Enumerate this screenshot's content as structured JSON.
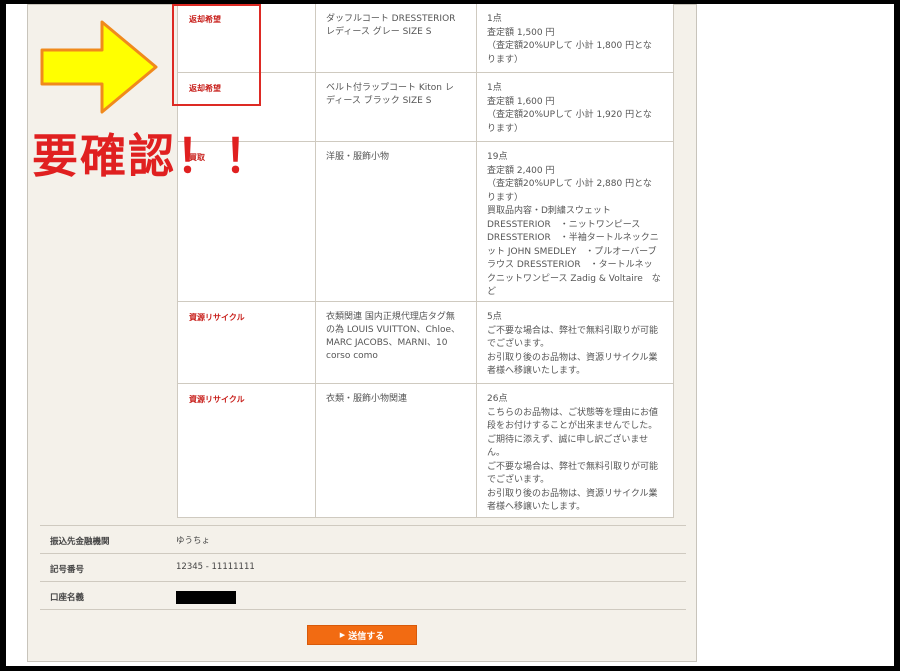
{
  "rows": [
    {
      "status": "返却希望",
      "item": [
        "ダッフルコート DRESSTERIOR",
        "レディース グレー SIZE S"
      ],
      "detail": [
        "1点",
        "査定額 1,500 円",
        "（査定額20%UPして 小計 1,800 円とな",
        "ります）"
      ]
    },
    {
      "status": "返却希望",
      "item": [
        "ベルト付ラップコート Kiton レ",
        "ディース ブラック SIZE S"
      ],
      "detail": [
        "1点",
        "査定額 1,600 円",
        "（査定額20%UPして 小計 1,920 円とな",
        "ります）"
      ]
    },
    {
      "status": "買取",
      "item": [
        "洋服・服飾小物"
      ],
      "detail": [
        "19点",
        "査定額 2,400 円",
        "（査定額20%UPして 小計 2,880 円とな",
        "ります）",
        "買取品内容・D刺繍スウェット",
        "DRESSTERIOR　・ニットワンピース",
        "DRESSTERIOR　・半袖タートルネックニ",
        "ット JOHN SMEDLEY　・プルオーバーブ",
        "ラウス DRESSTERIOR　・タートルネッ",
        "クニットワンピース Zadig & Voltaire　な",
        "ど"
      ]
    },
    {
      "status": "資源リサイクル",
      "item": [
        "衣類関連 国内正規代理店タグ無",
        "の為 LOUIS VUITTON、Chloe、",
        "MARC JACOBS、MARNI、10",
        "corso como"
      ],
      "detail": [
        "5点",
        "ご不要な場合は、弊社で無料引取りが可能",
        "でございます。",
        "お引取り後のお品物は、資源リサイクル業",
        "者様へ移譲いたします。"
      ]
    },
    {
      "status": "資源リサイクル",
      "item": [
        "衣類・服飾小物関連"
      ],
      "detail": [
        "26点",
        "こちらのお品物は、ご状態等を理由にお値",
        "段をお付けすることが出来ませんでした。",
        "ご期待に添えず、誠に申し訳ございませ",
        "ん。",
        "ご不要な場合は、弊社で無料引取りが可能",
        "でございます。",
        "お引取り後のお品物は、資源リサイクル業",
        "者様へ移譲いたします。"
      ]
    }
  ],
  "bank": {
    "label": "振込先金融機関",
    "value": "ゆうちょ"
  },
  "account_number": {
    "label": "記号番号",
    "value": "12345 - 11111111"
  },
  "account_name": {
    "label": "口座名義"
  },
  "submit": {
    "label": "送信する"
  },
  "annotation": {
    "alert": "要確認！！"
  },
  "colors": {
    "status_red": "#c8201c",
    "button_orange": "#f26b12",
    "arrow_yellow": "#ffff00",
    "alert_red": "#e02020"
  }
}
